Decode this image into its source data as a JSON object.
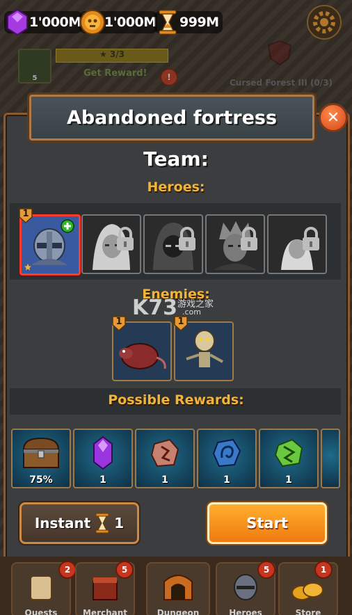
{
  "hud": {
    "gems": "1'000M",
    "coins": "1'000M",
    "hourglass": "999M"
  },
  "background": {
    "quest_count": "5",
    "star_progress": "★ 3/3",
    "get_reward": "Get Reward!",
    "alert": "!",
    "cursed_forest": "Cursed Forest III (0/3)"
  },
  "dialog": {
    "title": "Abandoned fortress",
    "team_heading": "Team:",
    "heroes_heading": "Heroes:",
    "enemies_heading": "Enemies:",
    "rewards_heading": "Possible Rewards:",
    "close_symbol": "✕"
  },
  "heroes": [
    {
      "name": "knight",
      "level": "1",
      "locked": false,
      "selected": true,
      "add": "+"
    },
    {
      "name": "white-haired-girl",
      "locked": true
    },
    {
      "name": "hooded-rogue",
      "locked": true
    },
    {
      "name": "scarred-warrior",
      "locked": true
    },
    {
      "name": "dark-mage",
      "locked": true
    }
  ],
  "enemies": [
    {
      "name": "giant-rat",
      "level": "1"
    },
    {
      "name": "skeleton",
      "level": "1"
    }
  ],
  "rewards": [
    {
      "name": "treasure-chest",
      "qty": "75%"
    },
    {
      "name": "purple-gem",
      "qty": "1"
    },
    {
      "name": "red-rune-stone",
      "qty": "1"
    },
    {
      "name": "blue-rune-stone",
      "qty": "1"
    },
    {
      "name": "green-rune-stone",
      "qty": "1"
    }
  ],
  "buttons": {
    "instant_label": "Instant",
    "instant_count": "1",
    "start_label": "Start"
  },
  "watermark": {
    "main": "K73",
    "sub": "游戏之家",
    "domain": ".com"
  },
  "nav": [
    {
      "label": "Quests",
      "badge": "2"
    },
    {
      "label": "Merchant",
      "badge": "5"
    },
    {
      "label": "Dungeon",
      "badge": ""
    },
    {
      "label": "Heroes",
      "badge": "5"
    },
    {
      "label": "Store",
      "badge": "1"
    }
  ],
  "colors": {
    "accent_orange": "#f07a10",
    "gold_text": "#f2b437",
    "frame_brown": "#8a5a33",
    "selection_red": "#ff3b2a"
  }
}
